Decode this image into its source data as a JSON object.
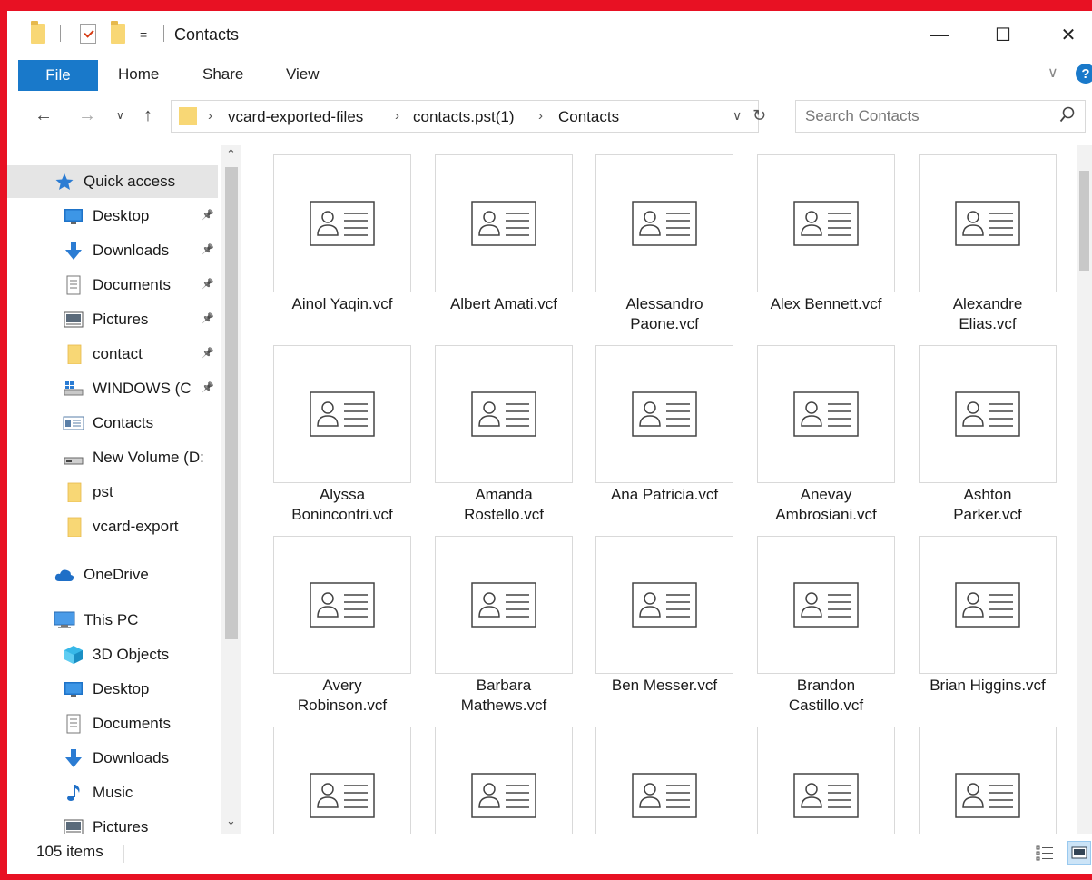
{
  "titlebar": {
    "title": "Contacts",
    "minimize": "—",
    "maximize": "☐",
    "close": "✕",
    "qa_dropdown": "="
  },
  "ribbon": {
    "tabs": [
      "File",
      "Home",
      "Share",
      "View"
    ],
    "chevron": "∨",
    "help": "?"
  },
  "nav": {
    "back": "←",
    "forward": "→",
    "recent": "∨",
    "up": "↑",
    "breadcrumb": [
      "vcard-exported-files",
      "contacts.pst(1)",
      "Contacts"
    ],
    "separator": "›",
    "address_dropdown": "∨",
    "refresh": "↻",
    "search_placeholder": "Search Contacts"
  },
  "sidebar": {
    "items": [
      {
        "label": "Quick access",
        "icon": "star-icon",
        "pinned": false,
        "selected": true,
        "level": 1
      },
      {
        "label": "Desktop",
        "icon": "desktop-icon",
        "pinned": true,
        "selected": false,
        "level": 2
      },
      {
        "label": "Downloads",
        "icon": "download-arrow-icon",
        "pinned": true,
        "selected": false,
        "level": 2
      },
      {
        "label": "Documents",
        "icon": "document-icon",
        "pinned": true,
        "selected": false,
        "level": 2
      },
      {
        "label": "Pictures",
        "icon": "pictures-icon",
        "pinned": true,
        "selected": false,
        "level": 2
      },
      {
        "label": "contact",
        "icon": "folder-icon",
        "pinned": true,
        "selected": false,
        "level": 2
      },
      {
        "label": "WINDOWS (C",
        "icon": "drive-windows-icon",
        "pinned": true,
        "selected": false,
        "level": 2
      },
      {
        "label": "Contacts",
        "icon": "contacts-card-icon",
        "pinned": false,
        "selected": false,
        "level": 2
      },
      {
        "label": "New Volume (D:",
        "icon": "drive-icon",
        "pinned": false,
        "selected": false,
        "level": 2
      },
      {
        "label": "pst",
        "icon": "folder-icon",
        "pinned": false,
        "selected": false,
        "level": 2
      },
      {
        "label": "vcard-export",
        "icon": "folder-icon",
        "pinned": false,
        "selected": false,
        "level": 2
      },
      {
        "label": "OneDrive",
        "icon": "cloud-icon",
        "pinned": false,
        "selected": false,
        "level": 1
      },
      {
        "label": "This PC",
        "icon": "computer-icon",
        "pinned": false,
        "selected": false,
        "level": 1
      },
      {
        "label": "3D Objects",
        "icon": "cube-icon",
        "pinned": false,
        "selected": false,
        "level": 2
      },
      {
        "label": "Desktop",
        "icon": "desktop-icon",
        "pinned": false,
        "selected": false,
        "level": 2
      },
      {
        "label": "Documents",
        "icon": "document-icon",
        "pinned": false,
        "selected": false,
        "level": 2
      },
      {
        "label": "Downloads",
        "icon": "download-arrow-icon",
        "pinned": false,
        "selected": false,
        "level": 2
      },
      {
        "label": "Music",
        "icon": "music-note-icon",
        "pinned": false,
        "selected": false,
        "level": 2
      },
      {
        "label": "Pictures",
        "icon": "pictures-icon",
        "pinned": false,
        "selected": false,
        "level": 2
      }
    ]
  },
  "files": [
    [
      "Ainol Yaqin.vcf"
    ],
    [
      "Albert Amati.vcf"
    ],
    [
      "Alessandro",
      "Paone.vcf"
    ],
    [
      "Alex Bennett.vcf"
    ],
    [
      "Alexandre",
      "Elias.vcf"
    ],
    [
      "Alyssa",
      "Bonincontri.vcf"
    ],
    [
      "Amanda",
      "Rostello.vcf"
    ],
    [
      "Ana Patricia.vcf"
    ],
    [
      "Anevay",
      "Ambrosiani.vcf"
    ],
    [
      "Ashton",
      "Parker.vcf"
    ],
    [
      "Avery",
      "Robinson.vcf"
    ],
    [
      "Barbara",
      "Mathews.vcf"
    ],
    [
      "Ben Messer.vcf"
    ],
    [
      "Brandon",
      "Castillo.vcf"
    ],
    [
      "Brian Higgins.vcf"
    ],
    [
      ""
    ],
    [
      ""
    ],
    [
      ""
    ],
    [
      ""
    ],
    [
      ""
    ]
  ],
  "status": {
    "item_count": "105 items"
  },
  "colors": {
    "accent": "#1979ca",
    "frame": "#e81123",
    "folder": "#f8d775"
  }
}
